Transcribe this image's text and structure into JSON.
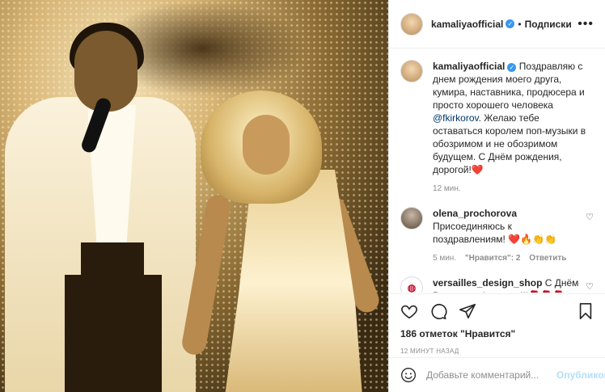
{
  "post": {
    "author": "kamaliyaofficial",
    "separator": "•",
    "follow_label": "Подписки",
    "more_label": "•••"
  },
  "caption": {
    "author": "kamaliyaofficial",
    "text_before": " Поздравляю с днем рождения моего друга, кумира, наставника, продюсера и просто хорошего человека ",
    "mention": "@fkirkorov",
    "text_after": ". Желаю тебе оставаться королем поп-музыки в обозримом и не обозримом будущем. С Днём рождения, дорогой!❤️",
    "time": "12 мин."
  },
  "comments": [
    {
      "author": "olena_prochorova",
      "text": "Присоединяюсь к поздравлениям! ❤️🔥👏👏",
      "time": "5 мин.",
      "likes": "\"Нравится\": 2",
      "reply": "Ответить"
    },
    {
      "author": "versailles_design_shop",
      "text": " С Днём Рождения Филиппа!!!🌹🌹🌹"
    }
  ],
  "likes_text": "186 отметок \"Нравится\"",
  "timestamp": "12 МИНУТ НАЗАД",
  "add_comment": {
    "placeholder": "Добавьте комментарий...",
    "publish_label": "Опубликовать"
  },
  "icons": [
    "heart-icon",
    "comment-icon",
    "share-icon",
    "bookmark-icon",
    "smile-icon",
    "verified-icon"
  ]
}
